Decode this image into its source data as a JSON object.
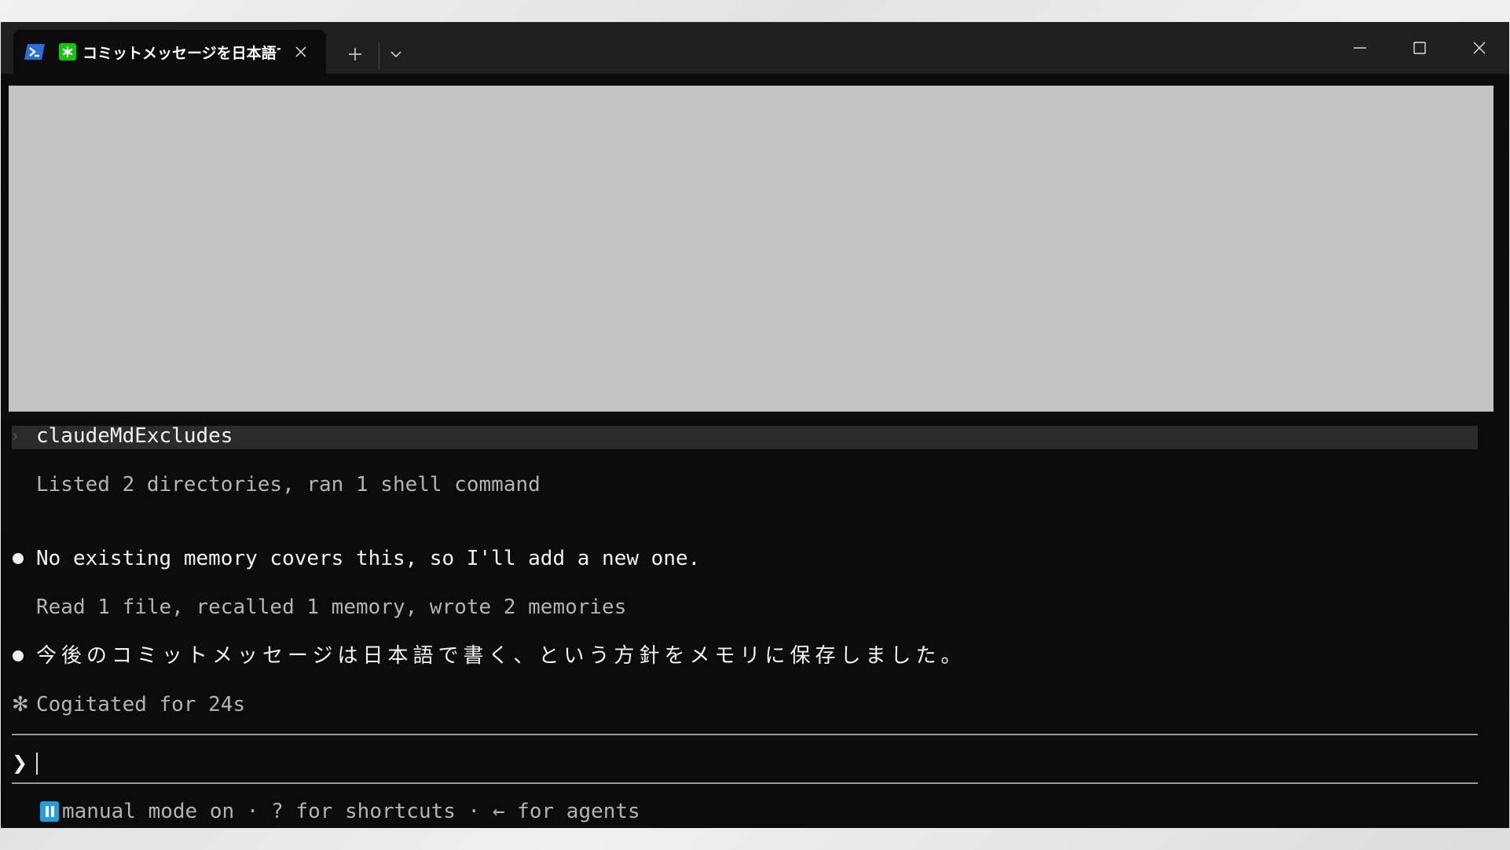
{
  "window": {
    "tab_title": "コミットメッセージを日本語で記",
    "icons": {
      "shell": "powershell-icon",
      "status": "asterisk-status-icon",
      "close_tab": "close-icon",
      "new_tab": "plus-icon",
      "dropdown": "chevron-down-icon",
      "minimize": "minimize-icon",
      "maximize": "maximize-icon",
      "close_window": "close-icon"
    }
  },
  "terminal": {
    "collapsed_item": "claudeMdExcludes",
    "summary_1": "Listed 2 directories, ran 1 shell command",
    "message_1": "No existing memory covers this, so I'll add a new one.",
    "summary_2": "Read 1 file, recalled 1 memory, wrote 2 memories",
    "message_2": "今後のコミットメッセージは日本語で書く、という方針をメモリに保存しました。",
    "spark_glyph": "✻",
    "status": "Cogitated for 24s",
    "prompt_glyph": "❯",
    "input_value": ""
  },
  "footer": {
    "text": "manual mode on · ? for shortcuts · ← for agents"
  },
  "colors": {
    "background": "#0c0c0c",
    "titlebar": "#202020",
    "redacted": "#c3c3c3",
    "text_bright": "#f2f2f2",
    "text_dim": "#b3b3b3",
    "accent_green": "#16c60c",
    "accent_blue": "#1e9fe0"
  }
}
